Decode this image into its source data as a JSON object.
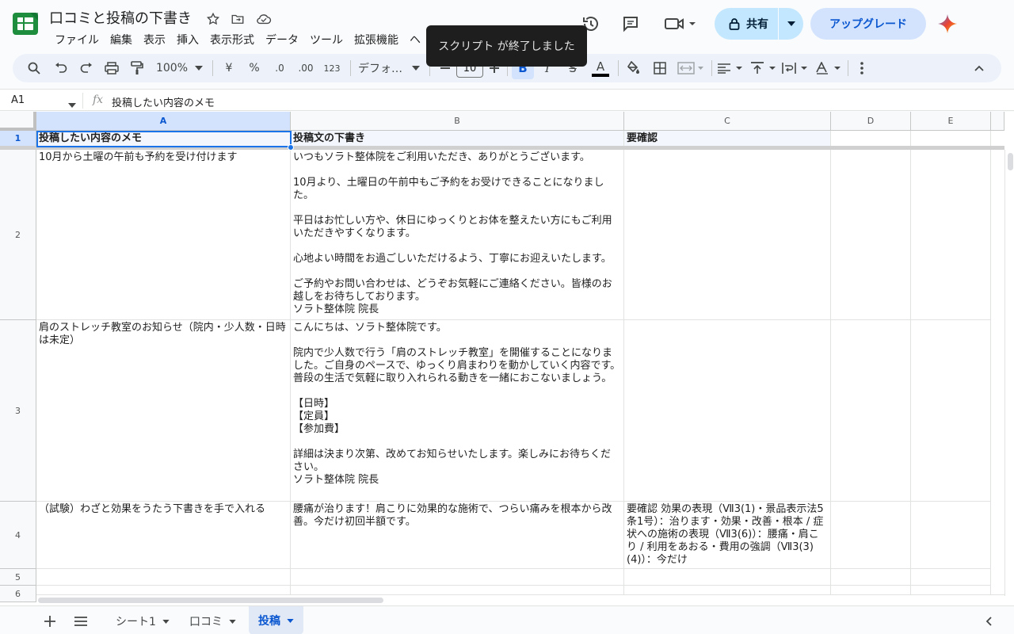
{
  "document": {
    "title": "口コミと投稿の下書き"
  },
  "menu": [
    "ファイル",
    "編集",
    "表示",
    "挿入",
    "表示形式",
    "データ",
    "ツール",
    "拡張機能",
    "ヘ"
  ],
  "header": {
    "share_label": "共有",
    "upgrade_label": "アップグレード"
  },
  "toast": {
    "message": "スクリプト が終了しました"
  },
  "toolbar": {
    "zoom": "100%",
    "currency": "¥",
    "percent": "%",
    "decrease_decimal": ".0",
    "increase_decimal": ".00",
    "number_format": "123",
    "font": "デフォ…",
    "font_size": "10",
    "bold": "B",
    "italic": "I",
    "strike": "S",
    "text_color_letter": "A"
  },
  "formula_bar": {
    "name_box": "A1",
    "fx": "fx",
    "value": "投稿したい内容のメモ"
  },
  "columns": [
    "A",
    "B",
    "C",
    "D",
    "E"
  ],
  "rows": [
    "1",
    "2",
    "3",
    "4",
    "5",
    "6"
  ],
  "cells": {
    "a1": "投稿したい内容のメモ",
    "b1": "投稿文の下書き",
    "c1": "要確認",
    "a2": "10月から土曜の午前も予約を受け付けます",
    "b2": "いつもソラト整体院をご利用いただき、ありがとうございます。\n\n10月より、土曜日の午前中もご予約をお受けできることになりました。\n\n平日はお忙しい方や、休日にゆっくりとお体を整えたい方にもご利用いただきやすくなります。\n\n心地よい時間をお過ごしいただけるよう、丁寧にお迎えいたします。\n\nご予約やお問い合わせは、どうぞお気軽にご連絡ください。皆様のお越しをお待ちしております。\nソラト整体院 院長",
    "a3": "肩のストレッチ教室のお知らせ（院内・少人数・日時は未定）",
    "b3": "こんにちは、ソラト整体院です。\n\n院内で少人数で行う「肩のストレッチ教室」を開催することになりました。ご自身のペースで、ゆっくり肩まわりを動かしていく内容です。普段の生活で気軽に取り入れられる動きを一緒におこないましょう。\n\n【日時】\n【定員】\n【参加費】\n\n詳細は決まり次第、改めてお知らせいたします。楽しみにお待ちください。\nソラト整体院 院長",
    "a4": "（試験）わざと効果をうたう下書きを手で入れる",
    "b4": "腰痛が治ります！肩こりに効果的な施術で、つらい痛みを根本から改善。今だけ初回半額です。",
    "c4": "要確認 効果の表現（Ⅶ3(1)・景品表示法5条1号）：治ります・効果・改善・根本 / 症状への施術の表現（Ⅶ3(6)）：腰痛・肩こり / 利用をあおる・費用の強調（Ⅶ3(3)(4)）：今だけ"
  },
  "sheets": [
    "シート1",
    "口コミ",
    "投稿"
  ],
  "active_sheet": "投稿",
  "colors": {
    "accent": "#0b57d0",
    "share_bg": "#c2e7ff",
    "upgrade_bg": "#d3e3fd",
    "selection": "#1a73e8"
  }
}
